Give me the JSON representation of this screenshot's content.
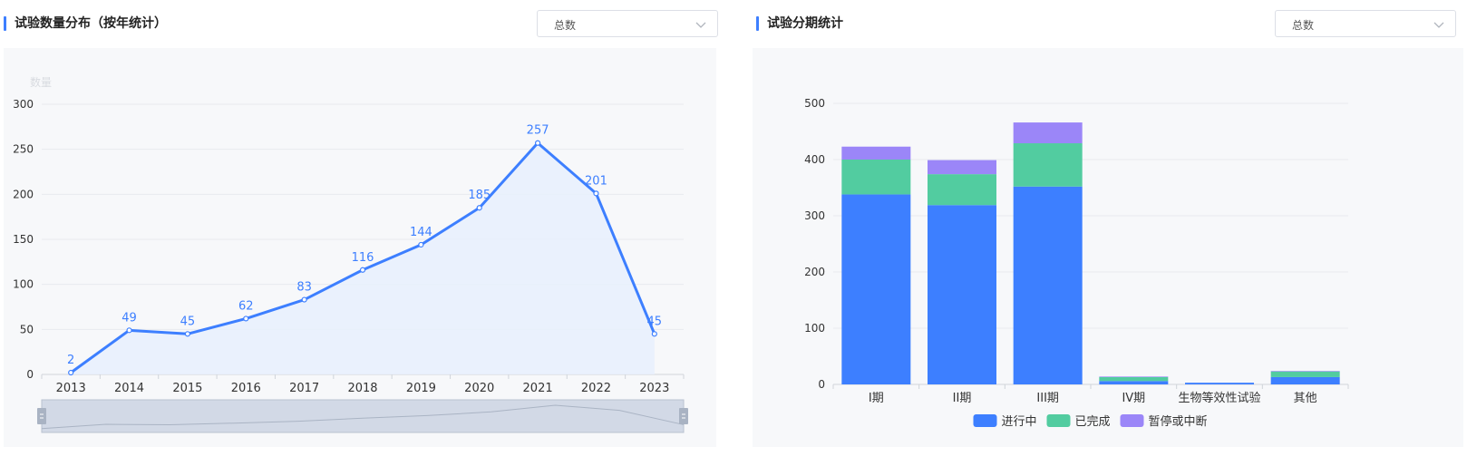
{
  "left_panel": {
    "title": "试验数量分布（按年统计）",
    "select_value": "总数"
  },
  "right_panel": {
    "title": "试验分期统计",
    "select_value": "总数"
  },
  "colors": {
    "accent": "#3d7fff",
    "ongoing": "#3d7fff",
    "completed": "#52cca0",
    "paused": "#9b86f8",
    "area_fill": "#e8f0fd",
    "zoom_fill": "#d2d9e6"
  },
  "chart_data": [
    {
      "type": "line",
      "ylabel": "数量",
      "x": [
        "2013",
        "2014",
        "2015",
        "2016",
        "2017",
        "2018",
        "2019",
        "2020",
        "2021",
        "2022",
        "2023"
      ],
      "series": [
        {
          "values": [
            2,
            49,
            45,
            62,
            83,
            116,
            144,
            185,
            257,
            201,
            45
          ]
        }
      ],
      "ylim": [
        0,
        300
      ],
      "yticks": [
        0,
        50,
        100,
        150,
        200,
        250,
        300
      ],
      "data_labels": true,
      "area": true,
      "grid": true,
      "datazoom": true
    },
    {
      "type": "bar",
      "stacked": true,
      "categories": [
        "I期",
        "II期",
        "III期",
        "IV期",
        "生物等效性试验",
        "其他"
      ],
      "series": [
        {
          "name": "进行中",
          "values": [
            338,
            319,
            352,
            6,
            3,
            13
          ]
        },
        {
          "name": "已完成",
          "values": [
            62,
            55,
            77,
            7,
            0,
            10
          ]
        },
        {
          "name": "暂停或中断",
          "values": [
            23,
            25,
            37,
            1,
            0,
            1
          ]
        }
      ],
      "ylim": [
        0,
        500
      ],
      "yticks": [
        0,
        100,
        200,
        300,
        400,
        500
      ],
      "legend": "bottom",
      "grid": true
    }
  ]
}
